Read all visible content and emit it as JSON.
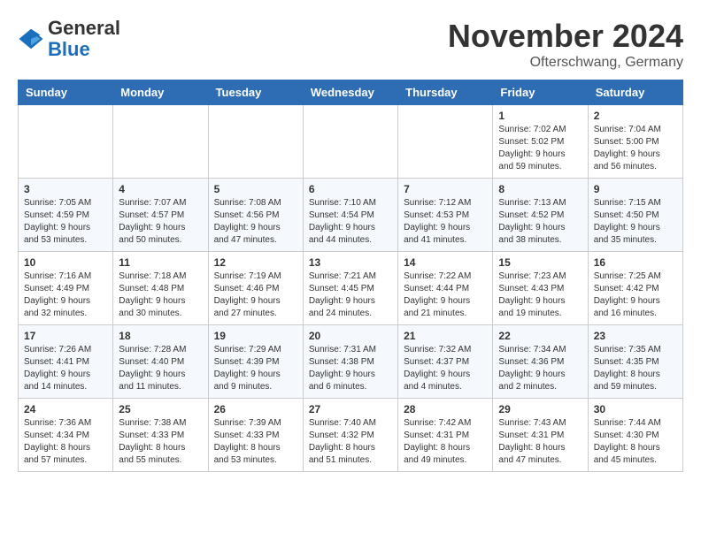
{
  "header": {
    "logo_general": "General",
    "logo_blue": "Blue",
    "month_title": "November 2024",
    "location": "Ofterschwang, Germany"
  },
  "days_of_week": [
    "Sunday",
    "Monday",
    "Tuesday",
    "Wednesday",
    "Thursday",
    "Friday",
    "Saturday"
  ],
  "weeks": [
    [
      {
        "day": "",
        "info": ""
      },
      {
        "day": "",
        "info": ""
      },
      {
        "day": "",
        "info": ""
      },
      {
        "day": "",
        "info": ""
      },
      {
        "day": "",
        "info": ""
      },
      {
        "day": "1",
        "info": "Sunrise: 7:02 AM\nSunset: 5:02 PM\nDaylight: 9 hours and 59 minutes."
      },
      {
        "day": "2",
        "info": "Sunrise: 7:04 AM\nSunset: 5:00 PM\nDaylight: 9 hours and 56 minutes."
      }
    ],
    [
      {
        "day": "3",
        "info": "Sunrise: 7:05 AM\nSunset: 4:59 PM\nDaylight: 9 hours and 53 minutes."
      },
      {
        "day": "4",
        "info": "Sunrise: 7:07 AM\nSunset: 4:57 PM\nDaylight: 9 hours and 50 minutes."
      },
      {
        "day": "5",
        "info": "Sunrise: 7:08 AM\nSunset: 4:56 PM\nDaylight: 9 hours and 47 minutes."
      },
      {
        "day": "6",
        "info": "Sunrise: 7:10 AM\nSunset: 4:54 PM\nDaylight: 9 hours and 44 minutes."
      },
      {
        "day": "7",
        "info": "Sunrise: 7:12 AM\nSunset: 4:53 PM\nDaylight: 9 hours and 41 minutes."
      },
      {
        "day": "8",
        "info": "Sunrise: 7:13 AM\nSunset: 4:52 PM\nDaylight: 9 hours and 38 minutes."
      },
      {
        "day": "9",
        "info": "Sunrise: 7:15 AM\nSunset: 4:50 PM\nDaylight: 9 hours and 35 minutes."
      }
    ],
    [
      {
        "day": "10",
        "info": "Sunrise: 7:16 AM\nSunset: 4:49 PM\nDaylight: 9 hours and 32 minutes."
      },
      {
        "day": "11",
        "info": "Sunrise: 7:18 AM\nSunset: 4:48 PM\nDaylight: 9 hours and 30 minutes."
      },
      {
        "day": "12",
        "info": "Sunrise: 7:19 AM\nSunset: 4:46 PM\nDaylight: 9 hours and 27 minutes."
      },
      {
        "day": "13",
        "info": "Sunrise: 7:21 AM\nSunset: 4:45 PM\nDaylight: 9 hours and 24 minutes."
      },
      {
        "day": "14",
        "info": "Sunrise: 7:22 AM\nSunset: 4:44 PM\nDaylight: 9 hours and 21 minutes."
      },
      {
        "day": "15",
        "info": "Sunrise: 7:23 AM\nSunset: 4:43 PM\nDaylight: 9 hours and 19 minutes."
      },
      {
        "day": "16",
        "info": "Sunrise: 7:25 AM\nSunset: 4:42 PM\nDaylight: 9 hours and 16 minutes."
      }
    ],
    [
      {
        "day": "17",
        "info": "Sunrise: 7:26 AM\nSunset: 4:41 PM\nDaylight: 9 hours and 14 minutes."
      },
      {
        "day": "18",
        "info": "Sunrise: 7:28 AM\nSunset: 4:40 PM\nDaylight: 9 hours and 11 minutes."
      },
      {
        "day": "19",
        "info": "Sunrise: 7:29 AM\nSunset: 4:39 PM\nDaylight: 9 hours and 9 minutes."
      },
      {
        "day": "20",
        "info": "Sunrise: 7:31 AM\nSunset: 4:38 PM\nDaylight: 9 hours and 6 minutes."
      },
      {
        "day": "21",
        "info": "Sunrise: 7:32 AM\nSunset: 4:37 PM\nDaylight: 9 hours and 4 minutes."
      },
      {
        "day": "22",
        "info": "Sunrise: 7:34 AM\nSunset: 4:36 PM\nDaylight: 9 hours and 2 minutes."
      },
      {
        "day": "23",
        "info": "Sunrise: 7:35 AM\nSunset: 4:35 PM\nDaylight: 8 hours and 59 minutes."
      }
    ],
    [
      {
        "day": "24",
        "info": "Sunrise: 7:36 AM\nSunset: 4:34 PM\nDaylight: 8 hours and 57 minutes."
      },
      {
        "day": "25",
        "info": "Sunrise: 7:38 AM\nSunset: 4:33 PM\nDaylight: 8 hours and 55 minutes."
      },
      {
        "day": "26",
        "info": "Sunrise: 7:39 AM\nSunset: 4:33 PM\nDaylight: 8 hours and 53 minutes."
      },
      {
        "day": "27",
        "info": "Sunrise: 7:40 AM\nSunset: 4:32 PM\nDaylight: 8 hours and 51 minutes."
      },
      {
        "day": "28",
        "info": "Sunrise: 7:42 AM\nSunset: 4:31 PM\nDaylight: 8 hours and 49 minutes."
      },
      {
        "day": "29",
        "info": "Sunrise: 7:43 AM\nSunset: 4:31 PM\nDaylight: 8 hours and 47 minutes."
      },
      {
        "day": "30",
        "info": "Sunrise: 7:44 AM\nSunset: 4:30 PM\nDaylight: 8 hours and 45 minutes."
      }
    ]
  ]
}
